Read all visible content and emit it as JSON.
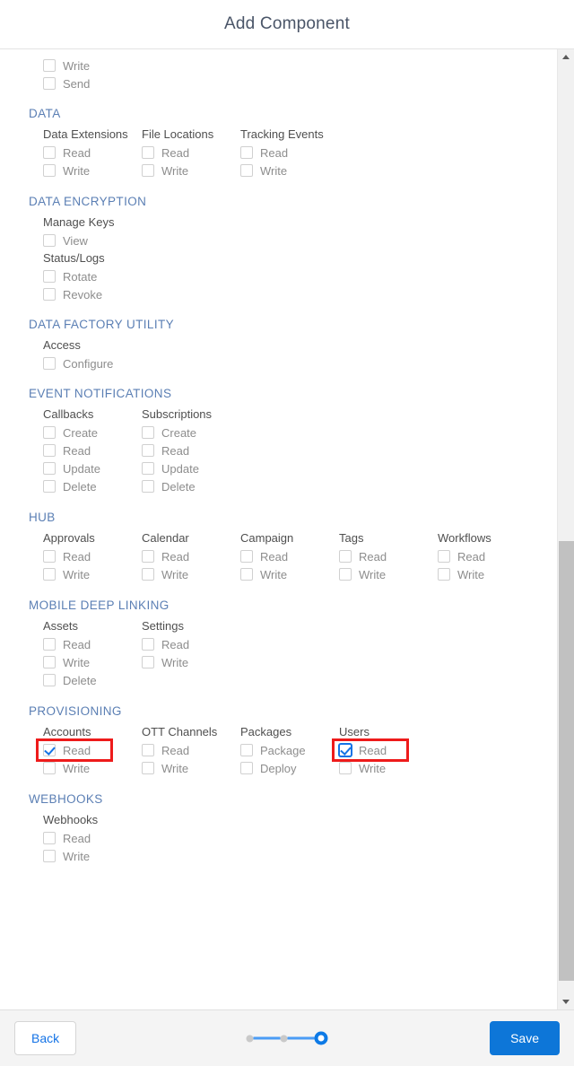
{
  "header": {
    "title": "Add Component"
  },
  "scrollbar": {
    "up_icon": "triangle-up-icon",
    "down_icon": "triangle-down-icon"
  },
  "orphan_options": [
    {
      "label": "Write",
      "checked": false
    },
    {
      "label": "Send",
      "checked": false
    }
  ],
  "sections": [
    {
      "id": "data",
      "title": "DATA",
      "layout": "columns",
      "columns": [
        {
          "head": "Data Extensions",
          "options": [
            {
              "label": "Read",
              "checked": false
            },
            {
              "label": "Write",
              "checked": false
            }
          ]
        },
        {
          "head": "File Locations",
          "options": [
            {
              "label": "Read",
              "checked": false
            },
            {
              "label": "Write",
              "checked": false
            }
          ]
        },
        {
          "head": "Tracking Events",
          "options": [
            {
              "label": "Read",
              "checked": false
            },
            {
              "label": "Write",
              "checked": false
            }
          ]
        }
      ]
    },
    {
      "id": "data-encryption",
      "title": "DATA ENCRYPTION",
      "layout": "stacked",
      "groups": [
        {
          "head": "Manage Keys",
          "options": [
            {
              "label": "View",
              "checked": false
            }
          ]
        },
        {
          "head": "Status/Logs",
          "options": [
            {
              "label": "Rotate",
              "checked": false
            },
            {
              "label": "Revoke",
              "checked": false
            }
          ]
        }
      ]
    },
    {
      "id": "data-factory-utility",
      "title": "DATA FACTORY UTILITY",
      "layout": "stacked",
      "groups": [
        {
          "head": "Access",
          "options": [
            {
              "label": "Configure",
              "checked": false
            }
          ]
        }
      ]
    },
    {
      "id": "event-notifications",
      "title": "EVENT NOTIFICATIONS",
      "layout": "columns",
      "columns": [
        {
          "head": "Callbacks",
          "options": [
            {
              "label": "Create",
              "checked": false
            },
            {
              "label": "Read",
              "checked": false
            },
            {
              "label": "Update",
              "checked": false
            },
            {
              "label": "Delete",
              "checked": false
            }
          ]
        },
        {
          "head": "Subscriptions",
          "options": [
            {
              "label": "Create",
              "checked": false
            },
            {
              "label": "Read",
              "checked": false
            },
            {
              "label": "Update",
              "checked": false
            },
            {
              "label": "Delete",
              "checked": false
            }
          ]
        }
      ]
    },
    {
      "id": "hub",
      "title": "HUB",
      "layout": "columns",
      "columns": [
        {
          "head": "Approvals",
          "options": [
            {
              "label": "Read",
              "checked": false
            },
            {
              "label": "Write",
              "checked": false
            }
          ]
        },
        {
          "head": "Calendar",
          "options": [
            {
              "label": "Read",
              "checked": false
            },
            {
              "label": "Write",
              "checked": false
            }
          ]
        },
        {
          "head": "Campaign",
          "options": [
            {
              "label": "Read",
              "checked": false
            },
            {
              "label": "Write",
              "checked": false
            }
          ]
        },
        {
          "head": "Tags",
          "options": [
            {
              "label": "Read",
              "checked": false
            },
            {
              "label": "Write",
              "checked": false
            }
          ]
        },
        {
          "head": "Workflows",
          "options": [
            {
              "label": "Read",
              "checked": false
            },
            {
              "label": "Write",
              "checked": false
            }
          ]
        }
      ]
    },
    {
      "id": "mobile-deep-linking",
      "title": "MOBILE DEEP LINKING",
      "layout": "columns",
      "columns": [
        {
          "head": "Assets",
          "options": [
            {
              "label": "Read",
              "checked": false
            },
            {
              "label": "Write",
              "checked": false
            },
            {
              "label": "Delete",
              "checked": false
            }
          ]
        },
        {
          "head": "Settings",
          "options": [
            {
              "label": "Read",
              "checked": false
            },
            {
              "label": "Write",
              "checked": false
            }
          ]
        }
      ]
    },
    {
      "id": "provisioning",
      "title": "PROVISIONING",
      "layout": "columns",
      "columns": [
        {
          "head": "Accounts",
          "options": [
            {
              "label": "Read",
              "checked": true,
              "highlighted": true
            },
            {
              "label": "Write",
              "checked": false
            }
          ]
        },
        {
          "head": "OTT Channels",
          "options": [
            {
              "label": "Read",
              "checked": false
            },
            {
              "label": "Write",
              "checked": false
            }
          ]
        },
        {
          "head": "Packages",
          "options": [
            {
              "label": "Package",
              "checked": false
            },
            {
              "label": "Deploy",
              "checked": false
            }
          ]
        },
        {
          "head": "Users",
          "options": [
            {
              "label": "Read",
              "checked": true,
              "highlighted": true,
              "focused": true
            },
            {
              "label": "Write",
              "checked": false
            }
          ]
        }
      ]
    },
    {
      "id": "webhooks",
      "title": "WEBHOOKS",
      "layout": "stacked",
      "groups": [
        {
          "head": "Webhooks",
          "options": [
            {
              "label": "Read",
              "checked": false
            },
            {
              "label": "Write",
              "checked": false
            }
          ]
        }
      ]
    }
  ],
  "footer": {
    "back_label": "Back",
    "save_label": "Save",
    "steps": {
      "total": 3,
      "active_index": 2
    }
  },
  "colors": {
    "accent": "#0d76d8",
    "link": "#1473e6",
    "section_header": "#5b7fb4",
    "title": "#4a5568",
    "highlight_box": "#ee1b1b",
    "checkbox_check": "#1473e6",
    "footer_bg": "#f4f4f4"
  }
}
